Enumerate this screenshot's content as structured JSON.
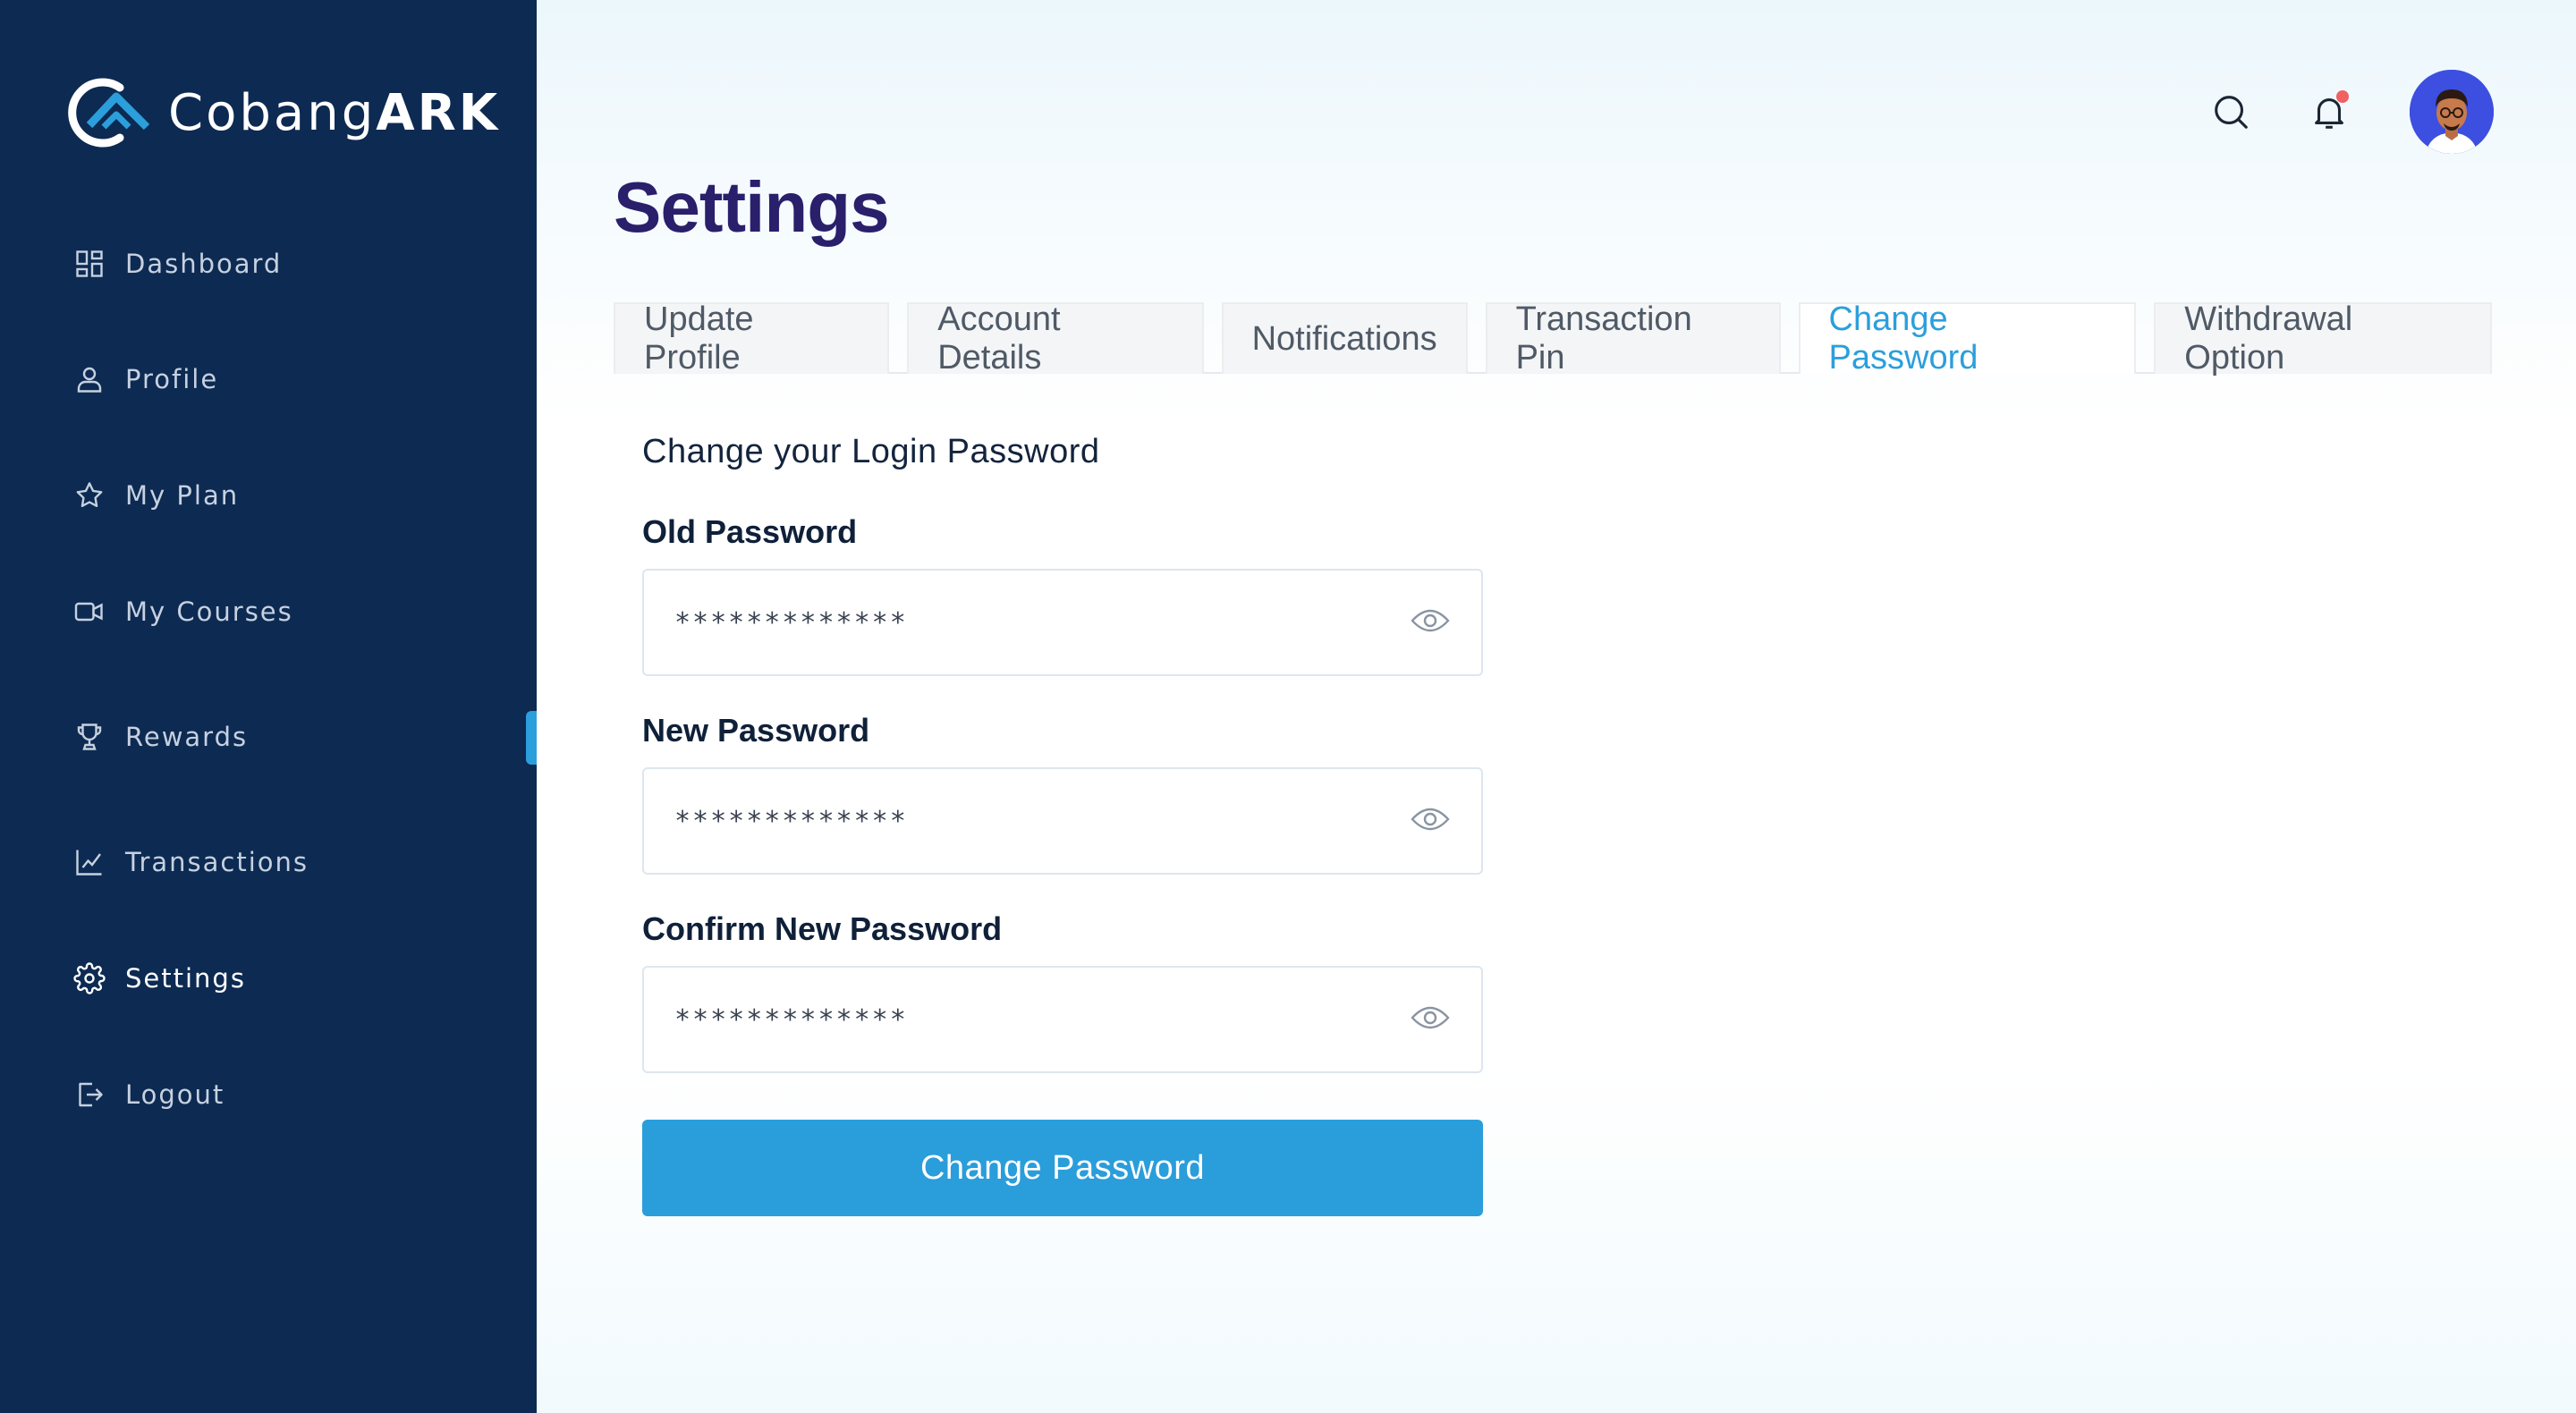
{
  "brand": {
    "name_light": "Cobang",
    "name_bold": "ARK"
  },
  "sidebar": {
    "items": [
      {
        "label": "Dashboard",
        "icon": "dashboard-icon"
      },
      {
        "label": "Profile",
        "icon": "user-icon"
      },
      {
        "label": "My Plan",
        "icon": "star-icon"
      },
      {
        "label": "My Courses",
        "icon": "video-icon"
      },
      {
        "label": "Rewards",
        "icon": "trophy-icon"
      },
      {
        "label": "Transactions",
        "icon": "chart-icon"
      },
      {
        "label": "Settings",
        "icon": "gear-icon",
        "active": true
      },
      {
        "label": "Logout",
        "icon": "logout-icon"
      }
    ]
  },
  "header": {
    "icons": [
      "search-icon",
      "bell-icon",
      "avatar"
    ]
  },
  "page": {
    "title": "Settings",
    "tabs": [
      {
        "label": "Update Profile"
      },
      {
        "label": "Account Details"
      },
      {
        "label": "Notifications"
      },
      {
        "label": "Transaction Pin"
      },
      {
        "label": "Change Password",
        "active": true
      },
      {
        "label": "Withdrawal Option"
      }
    ]
  },
  "form": {
    "heading": "Change your Login Password",
    "fields": [
      {
        "label": "Old Password",
        "value": "*************"
      },
      {
        "label": "New Password",
        "value": "*************"
      },
      {
        "label": "Confirm New Password",
        "value": "*************"
      }
    ],
    "submit_label": "Change Password"
  },
  "colors": {
    "sidebar_bg": "#0d2a52",
    "accent": "#2a9ddb",
    "title": "#2a1f6b",
    "notification_dot": "#f06161"
  }
}
